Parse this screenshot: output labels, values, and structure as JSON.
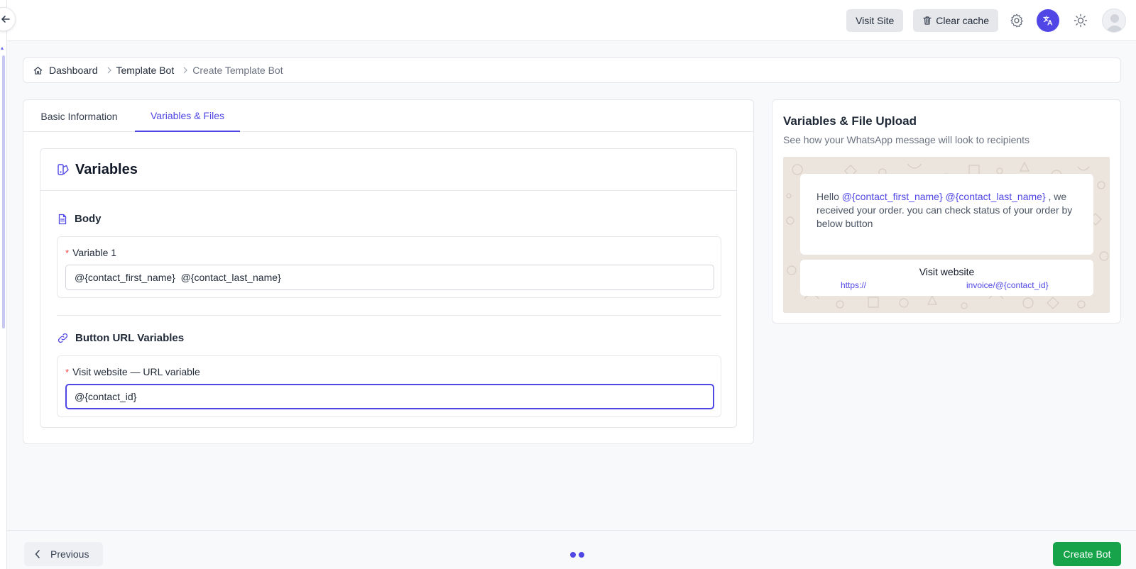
{
  "topbar": {
    "visit_site_label": "Visit Site",
    "clear_cache_label": "Clear cache"
  },
  "breadcrumb": {
    "items": [
      "Dashboard",
      "Template Bot",
      "Create Template Bot"
    ]
  },
  "tabs": [
    {
      "label": "Basic Information",
      "active": false
    },
    {
      "label": "Variables & Files",
      "active": true
    }
  ],
  "variables": {
    "title": "Variables",
    "body_section_title": "Body",
    "body_fields": [
      {
        "label": "Variable 1",
        "required": true,
        "value": "@{contact_first_name}  @{contact_last_name}"
      }
    ],
    "button_section_title": "Button URL Variables",
    "button_fields": [
      {
        "label": "Visit website — URL variable",
        "required": true,
        "value": "@{contact_id}"
      }
    ]
  },
  "preview": {
    "title": "Variables & File Upload",
    "subtitle": "See how your WhatsApp message will look to recipients",
    "message_prefix": "Hello ",
    "token_1": "@{contact_first_name}",
    "token_2": "@{contact_last_name}",
    "message_suffix": " , we received your order. you can check status of your order by below button",
    "button_label": "Visit website",
    "button_url_prefix": "https://",
    "button_url_suffix": "invoice/@{contact_id}"
  },
  "footer": {
    "previous_label": "Previous",
    "create_label": "Create Bot",
    "steps_total": 2
  },
  "colors": {
    "accent": "#4f46e5",
    "success": "#16a34a",
    "required": "#ef4444",
    "whatsapp_bg": "#ece5dd"
  }
}
